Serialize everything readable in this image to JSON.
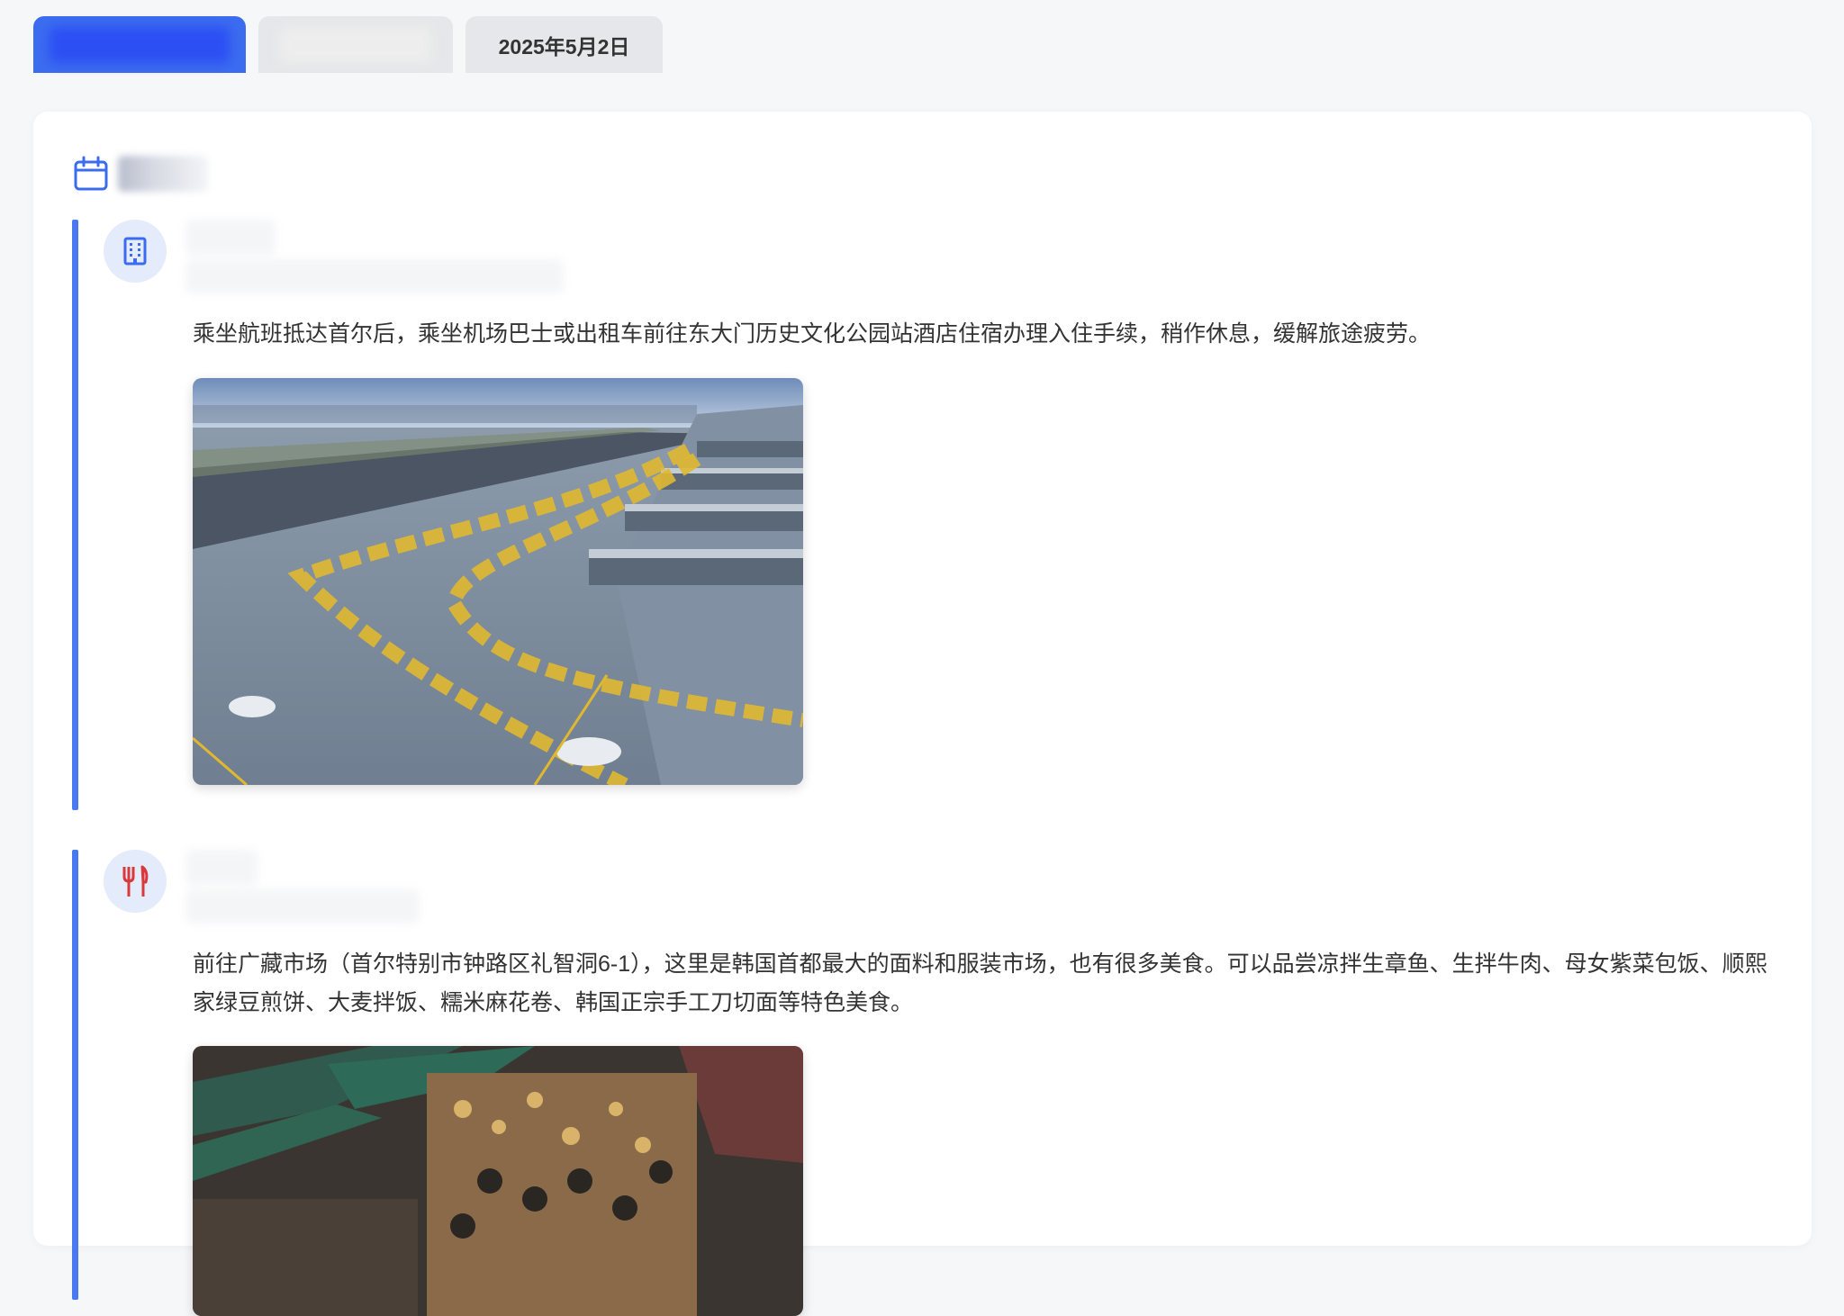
{
  "tabs": [
    {
      "label": ""
    },
    {
      "label": ""
    },
    {
      "label": "2025年5月2日"
    }
  ],
  "day": {
    "title": ""
  },
  "activities": [
    {
      "type": "hotel",
      "icon": "building-icon",
      "title": "",
      "description": "乘坐航班抵达首尔后，乘坐机场巴士或出租车前往东大门历史文化公园站酒店住宿办理入住手续，稍作休息，缓解旅途疲劳。",
      "image": "airport-taxi-photo"
    },
    {
      "type": "food",
      "icon": "fork-knife-icon",
      "title": "",
      "description": "前往广藏市场（首尔特别市钟路区礼智洞6-1），这里是韩国首都最大的面料和服装市场，也有很多美食。可以品尝凉拌生章鱼、生拌牛肉、母女紫菜包饭、顺熙家绿豆煎饼、大麦拌饭、糯米麻花卷、韩国正宗手工刀切面等特色美食。",
      "image": "market-photo"
    }
  ],
  "colors": {
    "accent": "#3b6cf0",
    "rail": "#4a78f0",
    "badge_bg": "#e4ebfb",
    "food_icon": "#d9393b"
  }
}
